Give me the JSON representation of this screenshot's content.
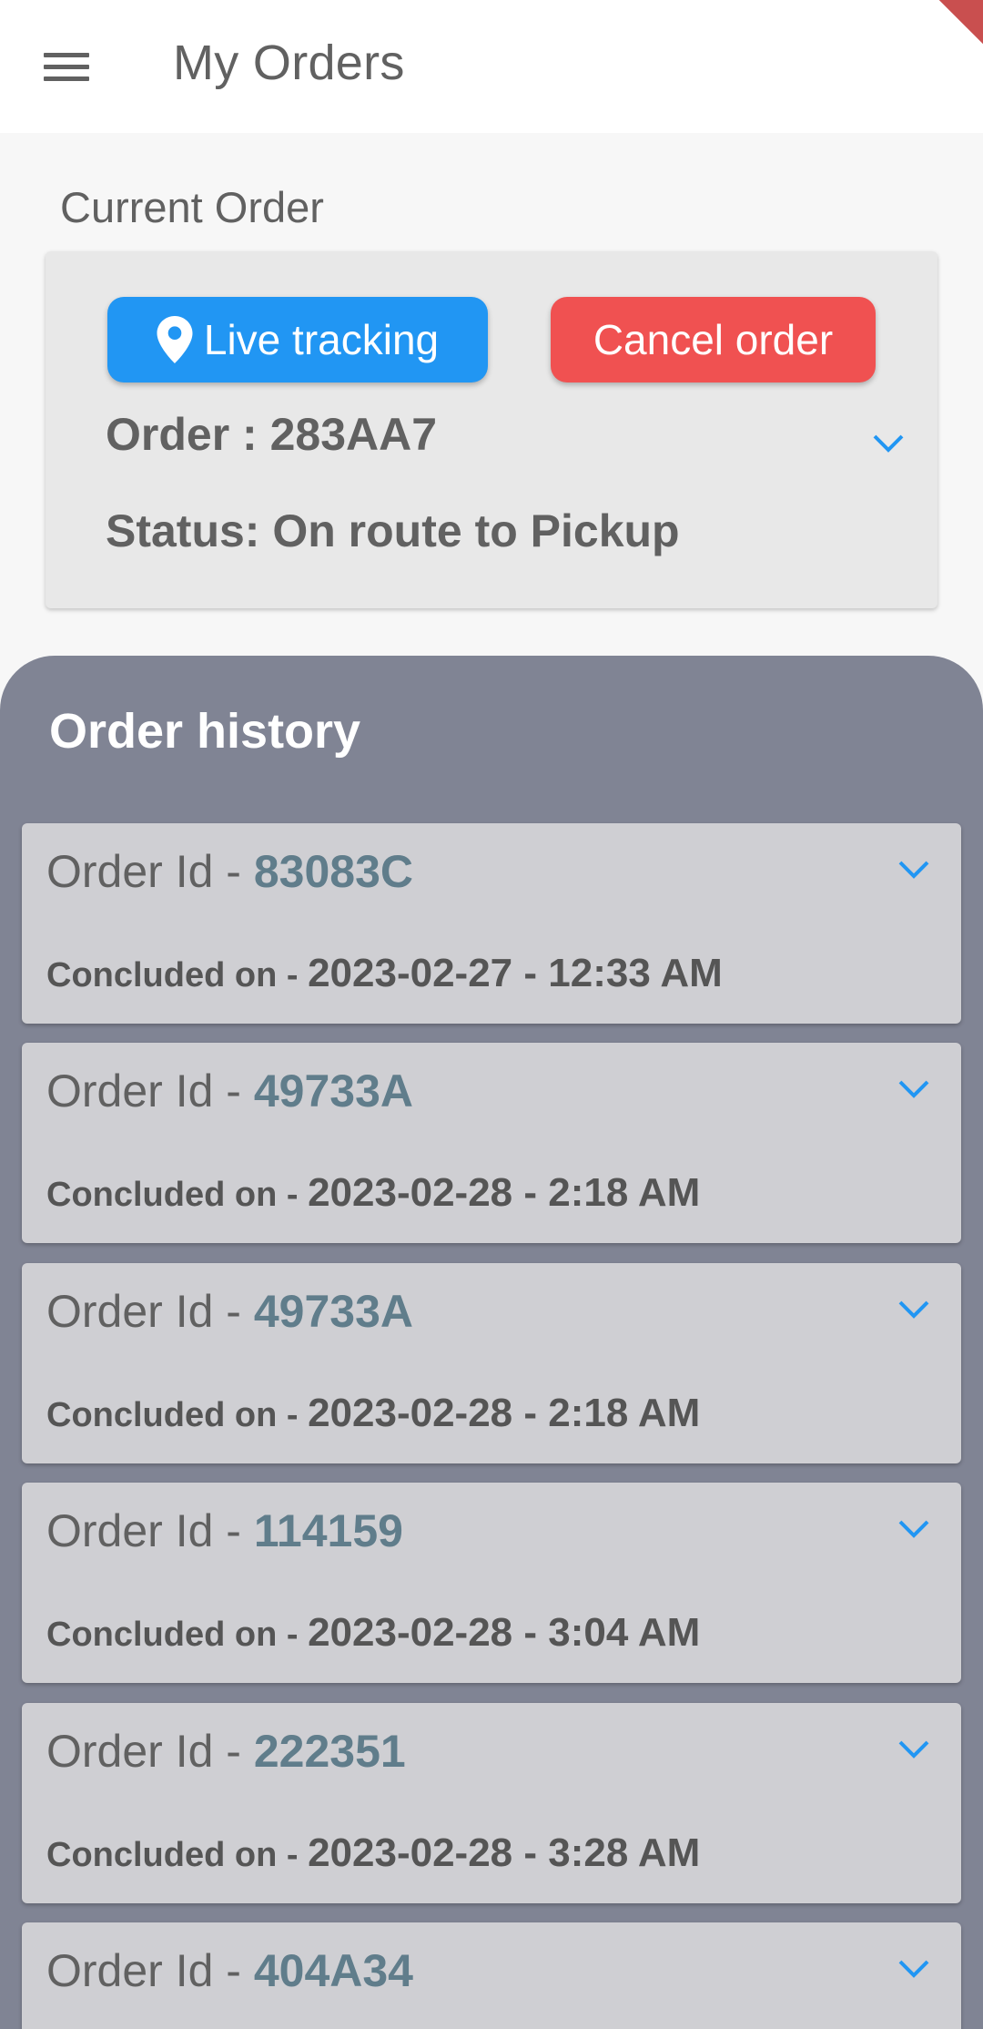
{
  "appbar": {
    "title": "My Orders"
  },
  "current": {
    "section_label": "Current Order",
    "live_tracking_label": "Live tracking",
    "cancel_label": "Cancel order",
    "order_line": "Order : 283AA7",
    "status_line": "Status: On route to Pickup"
  },
  "history": {
    "title": "Order history",
    "id_prefix": "Order Id - ",
    "concluded_label": "Concluded on - ",
    "items": [
      {
        "id": "83083C",
        "date": "2023-02-27 - 12:33 AM"
      },
      {
        "id": "49733A",
        "date": "2023-02-28 - 2:18 AM"
      },
      {
        "id": "49733A",
        "date": "2023-02-28 - 2:18 AM"
      },
      {
        "id": "114159",
        "date": "2023-02-28 - 3:04 AM"
      },
      {
        "id": "222351",
        "date": "2023-02-28 - 3:28 AM"
      },
      {
        "id": "404A34",
        "date": ""
      }
    ]
  },
  "colors": {
    "primary_blue": "#2196f3",
    "cancel_red": "#f05151",
    "history_bg": "#808494",
    "id_accent": "#607d8b"
  },
  "icons": {
    "menu": "menu-icon",
    "pin": "location-pin-icon",
    "expand": "chevron-down-icon"
  }
}
